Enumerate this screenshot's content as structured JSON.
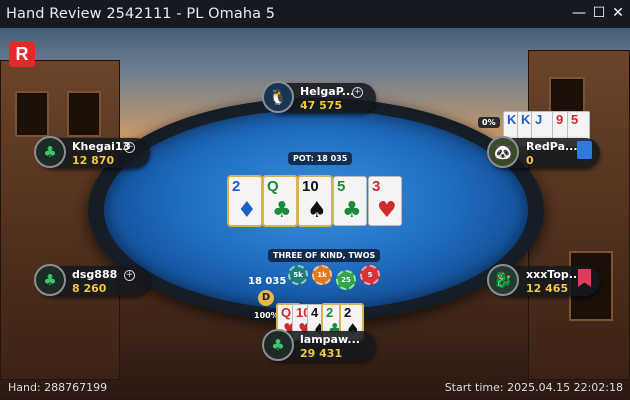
{
  "window": {
    "title": "Hand Review 2542111 - PL Omaha 5",
    "logo_letter": "R"
  },
  "table": {
    "pot_label": "POT: 18 035",
    "hand_strength": "THREE OF KIND, TWOS",
    "bet_amount": "18 035",
    "dealer_button": "D",
    "board": [
      {
        "rank": "2",
        "suit": "♦",
        "color": "#1f5fc8"
      },
      {
        "rank": "Q",
        "suit": "♣",
        "color": "#1c8a3a"
      },
      {
        "rank": "10",
        "suit": "♠",
        "color": "#111111"
      },
      {
        "rank": "5",
        "suit": "♣",
        "color": "#1c8a3a"
      },
      {
        "rank": "3",
        "suit": "♥",
        "color": "#d22a2a"
      }
    ],
    "chips": [
      {
        "label": "5k",
        "color": "#1e7f7a"
      },
      {
        "label": "1k",
        "color": "#e07a1f"
      },
      {
        "label": "25",
        "color": "#2fa64a"
      },
      {
        "label": "5",
        "color": "#d8323a"
      }
    ]
  },
  "players": {
    "top": {
      "name": "HelgaP...",
      "stack": "47 575",
      "avatar": "🐧"
    },
    "left_upper": {
      "name": "Khegai13",
      "stack": "12 870",
      "avatar": "♣"
    },
    "left_lower": {
      "name": "dsg888",
      "stack": "8 260",
      "avatar": "♣"
    },
    "right_upper": {
      "name": "RedPa...",
      "stack": "0",
      "avatar": "🐼",
      "equity": "0%",
      "cards": [
        {
          "rank": "K",
          "color": "#1f5fc8"
        },
        {
          "rank": "K",
          "color": "#1f5fc8"
        },
        {
          "rank": "J",
          "color": "#1f5fc8"
        },
        {
          "rank": "9",
          "color": "#d22a2a"
        },
        {
          "rank": "5",
          "color": "#d22a2a"
        }
      ]
    },
    "right_lower": {
      "name": "xxxTop...",
      "stack": "12 465",
      "avatar": "🐉"
    },
    "hero": {
      "name": "lampaw...",
      "stack": "29 431",
      "avatar": "♣",
      "equity": "100%",
      "cards": [
        {
          "rank": "Q",
          "suit": "♥",
          "color": "#d22a2a"
        },
        {
          "rank": "10",
          "suit": "♥",
          "color": "#d22a2a"
        },
        {
          "rank": "4",
          "suit": "♠",
          "color": "#111111"
        },
        {
          "rank": "2",
          "suit": "♣",
          "color": "#1c8a3a"
        },
        {
          "rank": "2",
          "suit": "♠",
          "color": "#111111"
        }
      ]
    }
  },
  "footer": {
    "hand": "Hand: 288767199",
    "start_time": "Start time: 2025.04.15 22:02:18"
  },
  "colors": {
    "brand_red": "#e32a2a",
    "stack_gold": "#f2c744",
    "felt_blue": "#1f6dc0"
  }
}
